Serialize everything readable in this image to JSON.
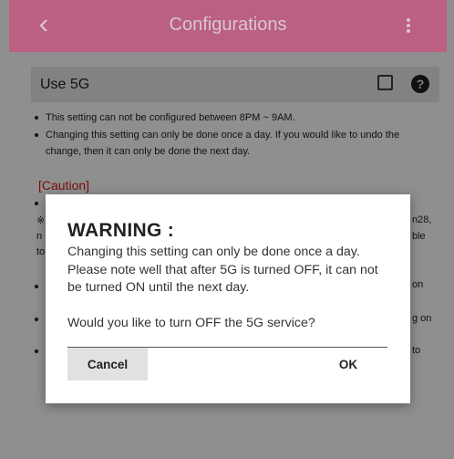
{
  "header": {
    "title": "Configurations",
    "back_icon": "chevron-left-icon",
    "menu_icon": "more-vert-icon",
    "color": "#bb5f83"
  },
  "option": {
    "label": "Use 5G",
    "checked": false,
    "help_icon": "help-circle-icon"
  },
  "notes": [
    "This setting can not be configured between 8PM ~ 9AM.",
    "Changing this setting can only be done once a day. If you would like to undo the change, then it can only be done the next day."
  ],
  "caution": {
    "heading": "[Caution]",
    "visible_fragments": [
      "※",
      "n28,",
      "n",
      "ble",
      "to",
      "on",
      "g on",
      "to"
    ]
  },
  "dialog": {
    "title": "WARNING :",
    "message": "Changing this setting can only be done once a day. Please note well that after 5G is turned OFF, it can not be turned ON until the next day.",
    "question": "Would you like to turn OFF the 5G service?",
    "cancel_label": "Cancel",
    "ok_label": "OK"
  }
}
